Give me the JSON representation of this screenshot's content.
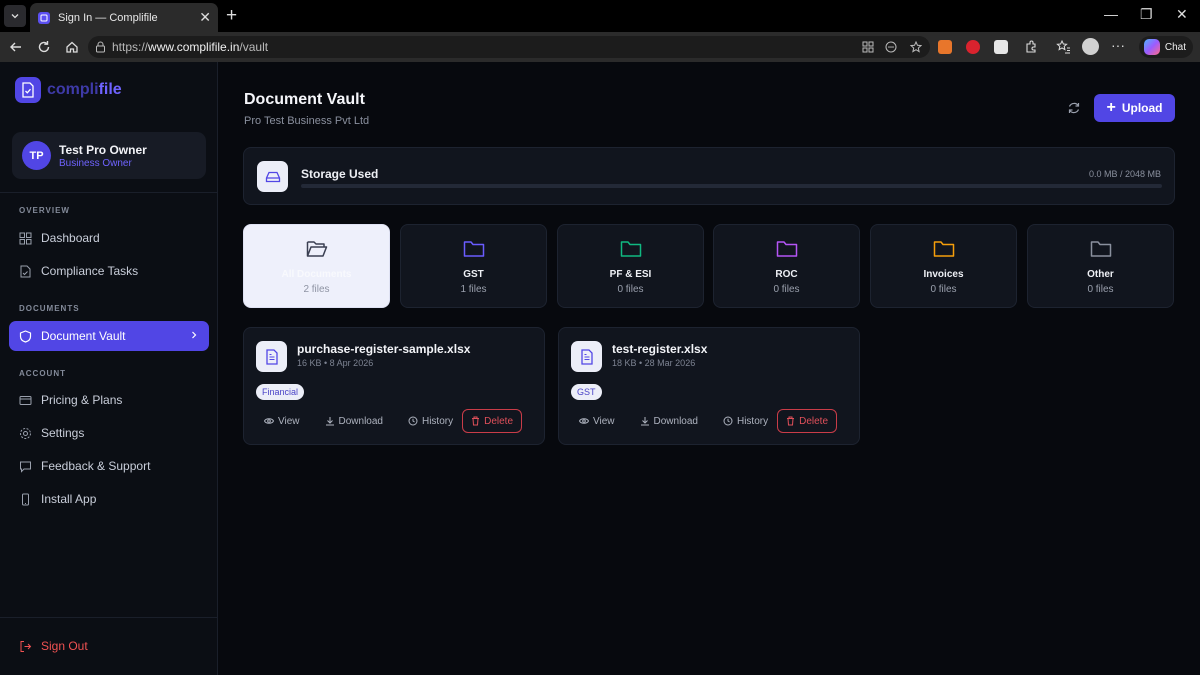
{
  "browser": {
    "tab_title": "Sign In — Complifile",
    "url_scheme": "https://",
    "url_host": "www.complifile.in",
    "url_path": "/vault",
    "chat_label": "Chat"
  },
  "brand": {
    "part1": "compli",
    "part2": "file",
    "color": "#5146e5"
  },
  "user": {
    "initials": "TP",
    "name": "Test Pro Owner",
    "role": "Business Owner"
  },
  "sidebar": {
    "sections": [
      {
        "label": "OVERVIEW",
        "items": [
          {
            "label": "Dashboard",
            "icon": "dashboard-icon"
          },
          {
            "label": "Compliance Tasks",
            "icon": "tasks-icon"
          }
        ]
      },
      {
        "label": "DOCUMENTS",
        "items": [
          {
            "label": "Document Vault",
            "icon": "shield-icon",
            "active": true
          }
        ]
      },
      {
        "label": "ACCOUNT",
        "items": [
          {
            "label": "Pricing & Plans",
            "icon": "card-icon"
          },
          {
            "label": "Settings",
            "icon": "gear-icon"
          },
          {
            "label": "Feedback & Support",
            "icon": "chat-icon"
          },
          {
            "label": "Install App",
            "icon": "phone-icon"
          }
        ]
      }
    ],
    "sign_out": "Sign Out"
  },
  "page": {
    "title": "Document Vault",
    "subtitle": "Pro Test Business Pvt Ltd",
    "upload_label": "Upload"
  },
  "storage": {
    "title": "Storage Used",
    "value_text": "0.0 MB / 2048 MB",
    "used_fraction": 0.0
  },
  "categories": [
    {
      "name": "All Documents",
      "count": "2 files",
      "color": "#3a3f52",
      "active": true
    },
    {
      "name": "GST",
      "count": "1 files",
      "color": "#6a5cff"
    },
    {
      "name": "PF & ESI",
      "count": "0 files",
      "color": "#10b981"
    },
    {
      "name": "ROC",
      "count": "0 files",
      "color": "#b455f5"
    },
    {
      "name": "Invoices",
      "count": "0 files",
      "color": "#f59e0b"
    },
    {
      "name": "Other",
      "count": "0 files",
      "color": "#8a909e"
    }
  ],
  "documents": [
    {
      "name": "purchase-register-sample.xlsx",
      "meta": "16 KB • 8 Apr 2026",
      "tag": "Financial"
    },
    {
      "name": "test-register.xlsx",
      "meta": "18 KB • 28 Mar 2026",
      "tag": "GST"
    }
  ],
  "doc_actions": {
    "view": "View",
    "download": "Download",
    "history": "History",
    "delete": "Delete"
  }
}
